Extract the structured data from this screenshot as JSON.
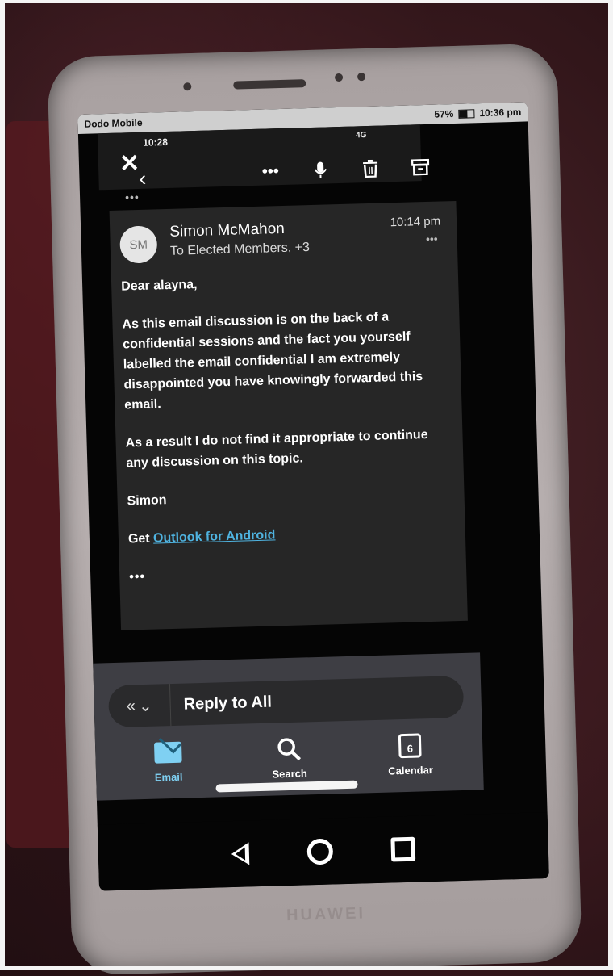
{
  "device": {
    "brand": "HUAWEI"
  },
  "status_bar": {
    "carrier": "Dodo Mobile",
    "battery": "57%",
    "time": "10:36 pm"
  },
  "inner_status": {
    "time": "10:28",
    "network": "4G"
  },
  "toolbar": {
    "close_icon": "close-icon",
    "back_icon": "back-chevron-icon",
    "more_icon": "more-horizontal-icon",
    "mic_icon": "microphone-icon",
    "delete_icon": "trash-icon",
    "archive_icon": "archive-icon"
  },
  "thread": {
    "collapsed_indicator": "•••"
  },
  "message": {
    "avatar_initials": "SM",
    "sender": "Simon McMahon",
    "recipients": "To Elected Members, +3",
    "time": "10:14 pm",
    "more": "•••",
    "greeting": "Dear alayna,",
    "paragraph1": "As this email discussion is on the back of a confidential sessions and the fact you yourself labelled the email confidential I am extremely disappointed you have knowingly forwarded this email.",
    "paragraph2": "As a result I do not find it appropriate to continue any discussion on this topic.",
    "signature": "Simon",
    "footer_prefix": "Get",
    "footer_link": "Outlook for Android",
    "quoted_text": "•••"
  },
  "reply": {
    "label": "Reply to All"
  },
  "tabs": [
    {
      "label": "Email",
      "icon": "mail-icon",
      "active": true
    },
    {
      "label": "Search",
      "icon": "search-icon",
      "active": false
    },
    {
      "label": "Calendar",
      "icon": "calendar-icon",
      "active": false,
      "day": "6"
    }
  ],
  "colors": {
    "accent": "#7fd0f2",
    "link": "#4fb3e0",
    "card": "#262626"
  }
}
